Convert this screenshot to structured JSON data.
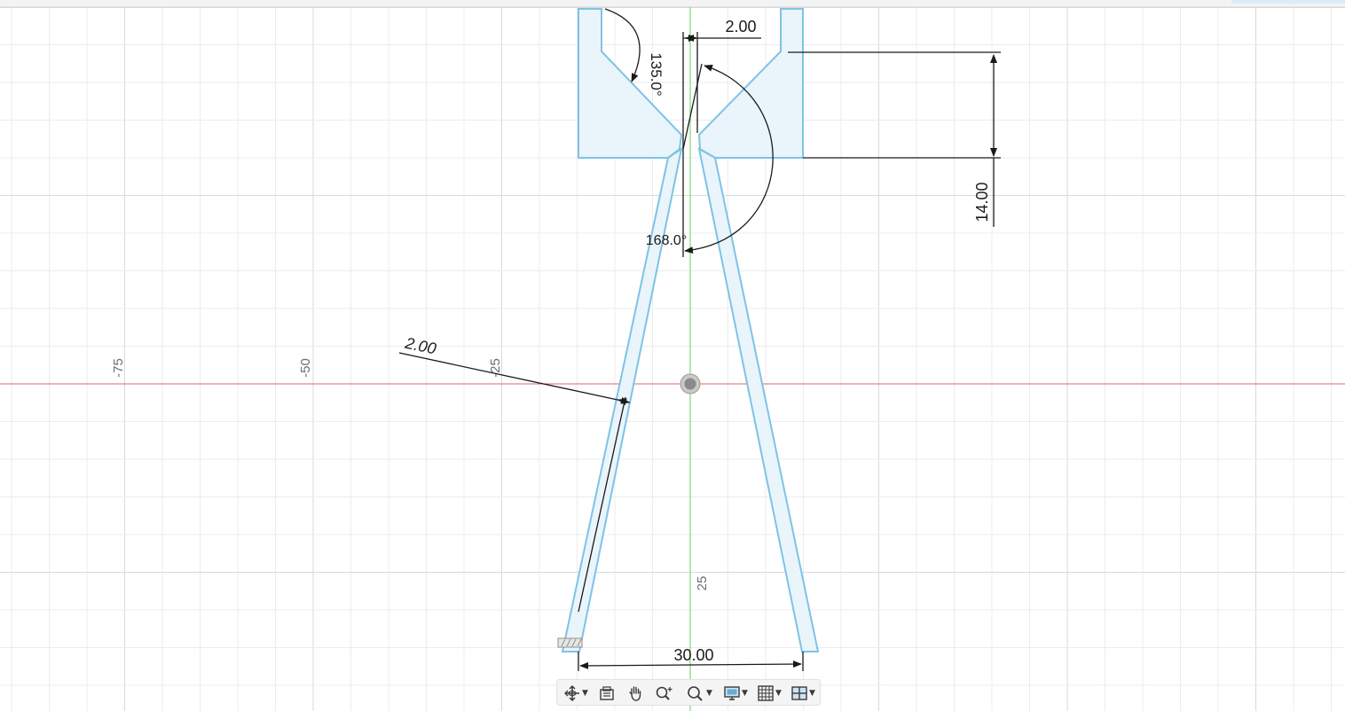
{
  "grid_labels": {
    "x_neg75": "-75",
    "x_neg50": "-50",
    "x_neg25": "-25",
    "y_25": "25"
  },
  "dimensions": {
    "gap_width": "2.00",
    "angle_upper": "135.0°",
    "angle_lower": "168.0°",
    "height": "14.00",
    "thickness": "2.00",
    "base_width": "30.00"
  },
  "toolbar": {
    "items": [
      {
        "name": "orbit",
        "icon": "orbit-icon",
        "has_dropdown": true
      },
      {
        "name": "look-at",
        "icon": "look-at-icon",
        "has_dropdown": false
      },
      {
        "name": "pan",
        "icon": "hand-icon",
        "has_dropdown": false
      },
      {
        "name": "zoom",
        "icon": "zoom-icon",
        "has_dropdown": false
      },
      {
        "name": "fit",
        "icon": "zoom-window-icon",
        "has_dropdown": true
      },
      {
        "name": "display-settings",
        "icon": "monitor-icon",
        "has_dropdown": true
      },
      {
        "name": "grid-settings",
        "icon": "grid-icon",
        "has_dropdown": true
      },
      {
        "name": "viewports",
        "icon": "viewports-icon",
        "has_dropdown": true
      }
    ]
  },
  "colors": {
    "grid_minor": "#ececec",
    "grid_major": "#d9d9d9",
    "x_axis": "#e06666",
    "y_axis": "#7fd67f",
    "sketch_stroke": "#7ec3e6",
    "sketch_fill": "#eaf4fb",
    "dimension": "#1a1a1a",
    "label": "#6e6e6e"
  }
}
